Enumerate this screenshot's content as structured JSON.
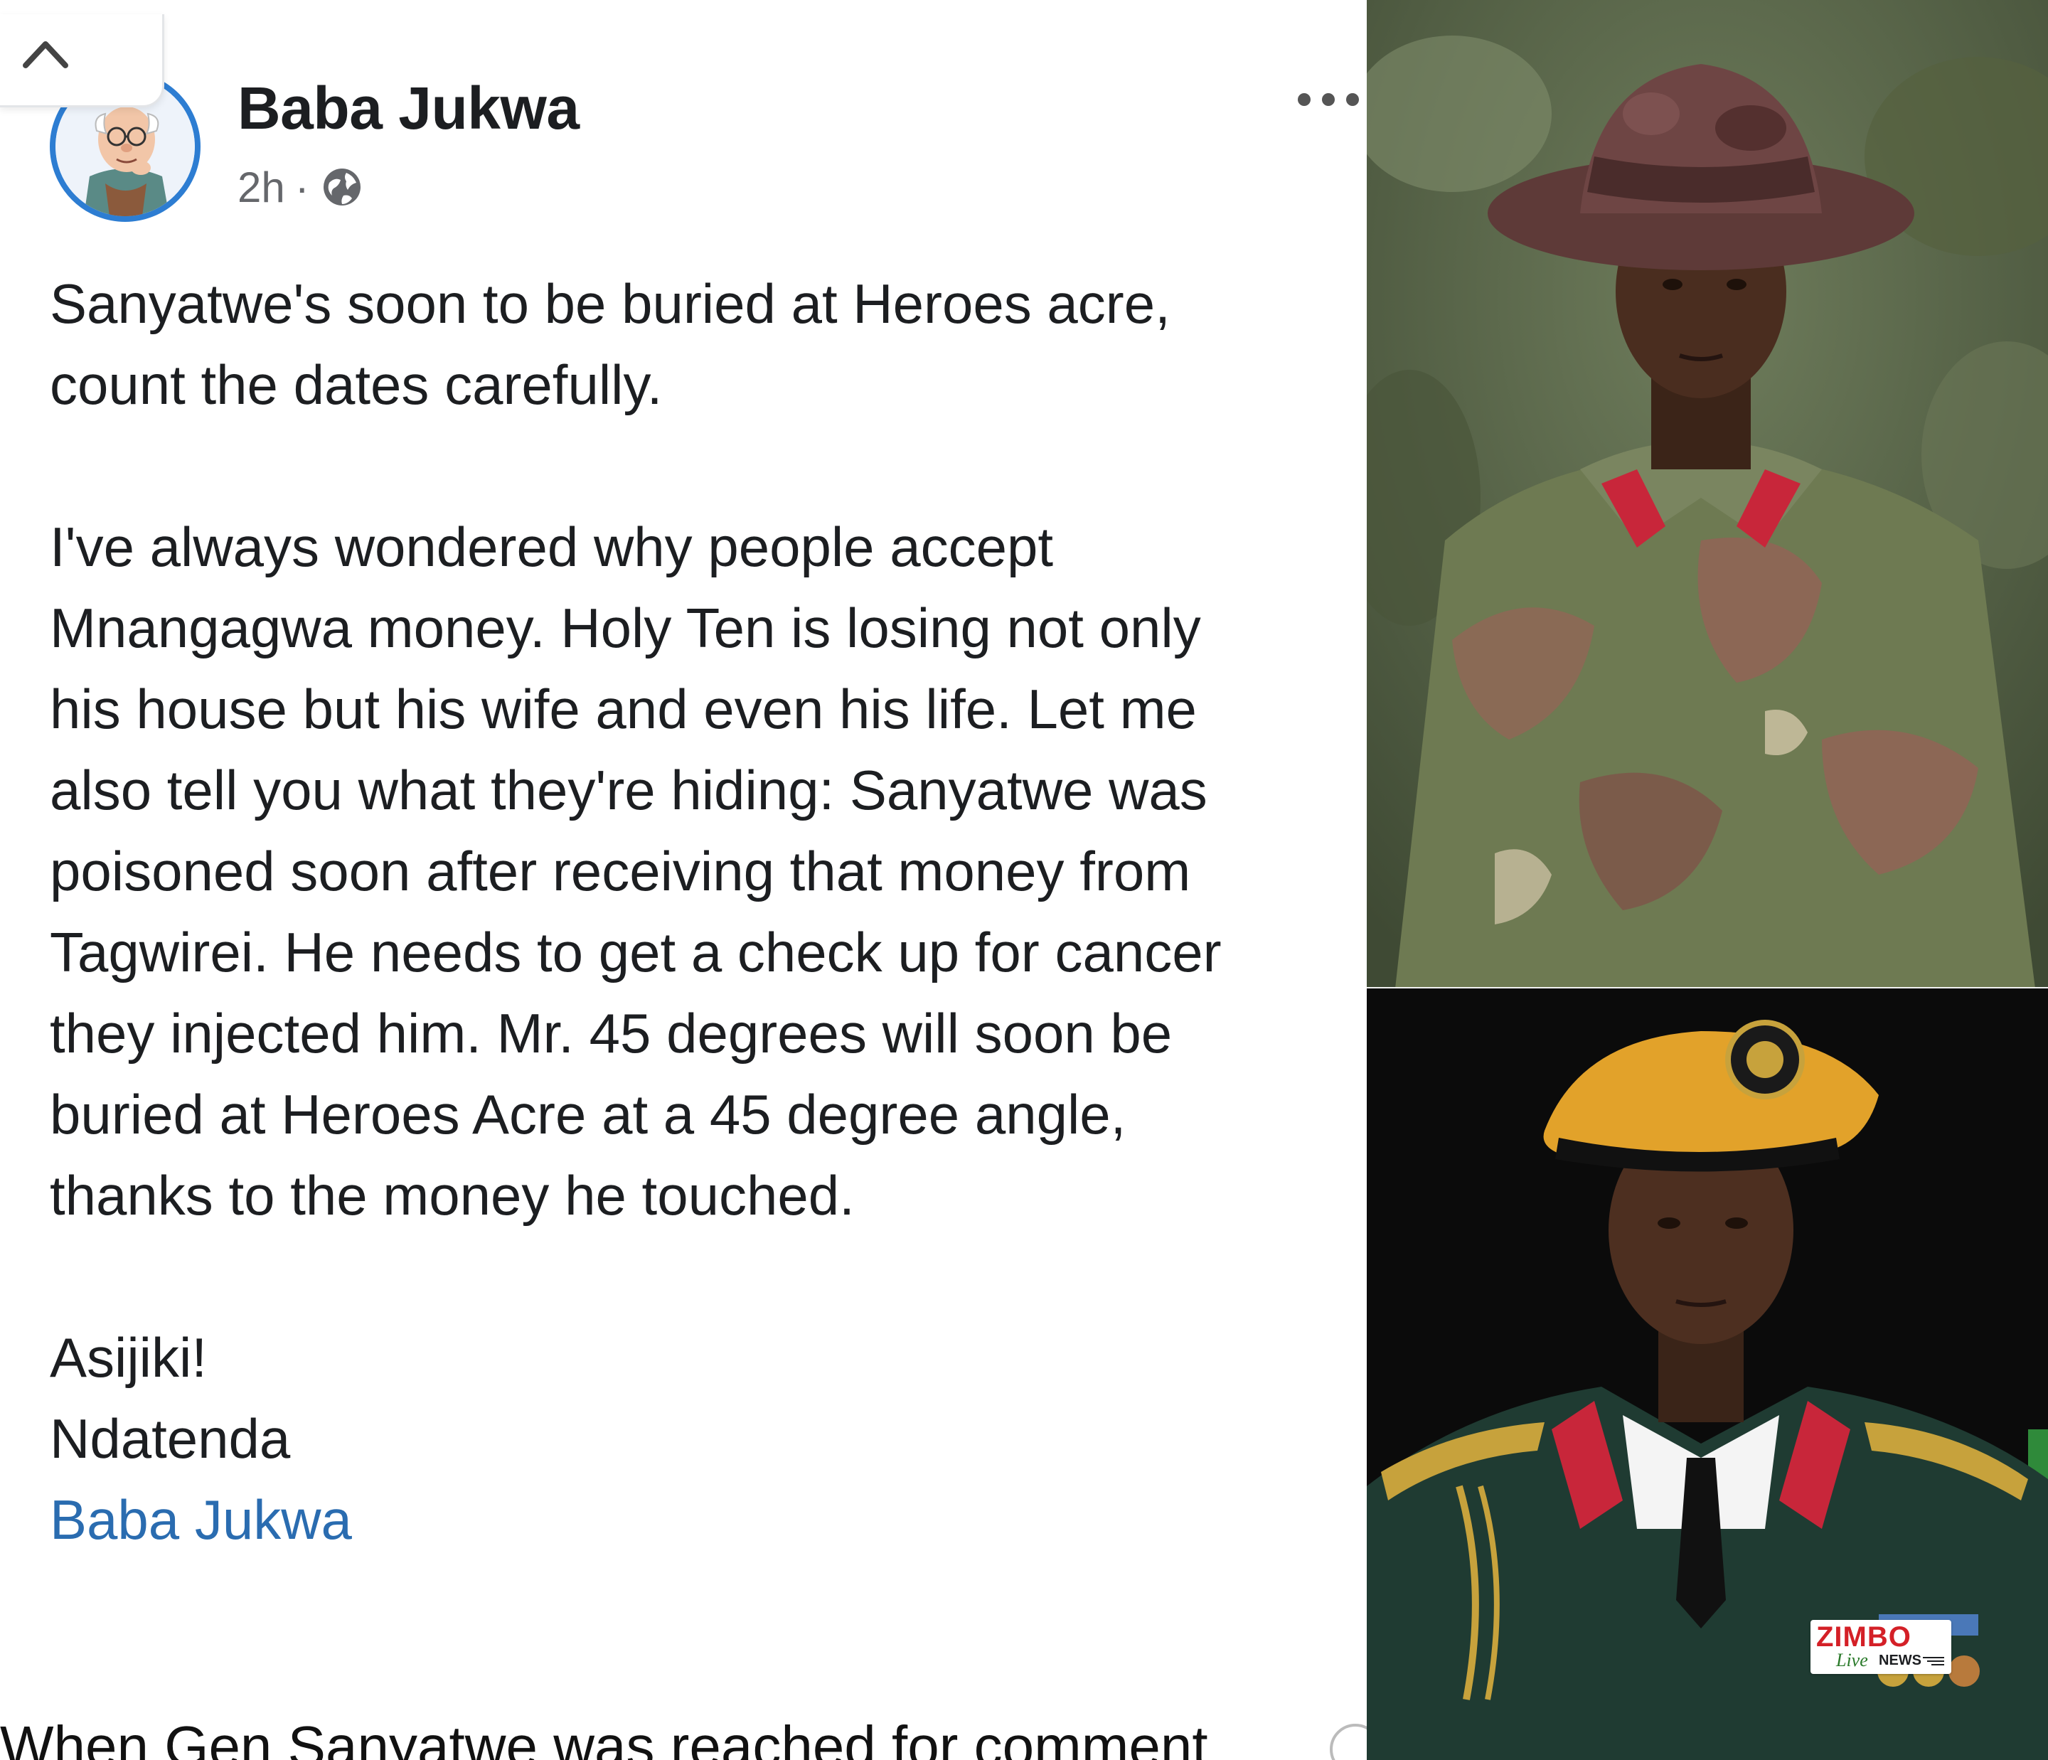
{
  "post": {
    "author": "Baba Jukwa",
    "time": "2h",
    "separator": "·",
    "paragraphs": {
      "p1": [
        "Sanyatwe's soon to be buried at Heroes acre,",
        "count the dates carefully."
      ],
      "p2": [
        "I've always wondered why people accept",
        "Mnangagwa money. Holy Ten is losing not only",
        "his house but his wife and even his life. Let me",
        "also tell you what they're hiding: Sanyatwe was",
        "poisoned soon after receiving that money from",
        "Tagwirei. He needs to get a check up for cancer",
        "they injected him. Mr. 45 degrees will soon be",
        "buried at Heroes Acre at a 45 degree angle,",
        "thanks to the money he touched."
      ],
      "p3": [
        "Asijiki!",
        "Ndatenda"
      ]
    },
    "signature_link": "Baba Jukwa"
  },
  "article": {
    "next_text": "When Gen Sanyatwe was reached for comment"
  },
  "watermark": {
    "brand": "ZIMBO",
    "live": "Live",
    "news": "NEWS"
  },
  "icons": {
    "collapse": "chevron-up-icon",
    "privacy": "globe-icon",
    "more": "more-horizontal-icon"
  },
  "colors": {
    "text": "#1c1e21",
    "meta": "#65676b",
    "link": "#2a6cb0",
    "avatar_ring": "#2d7dd2",
    "brand_red": "#d42027"
  }
}
